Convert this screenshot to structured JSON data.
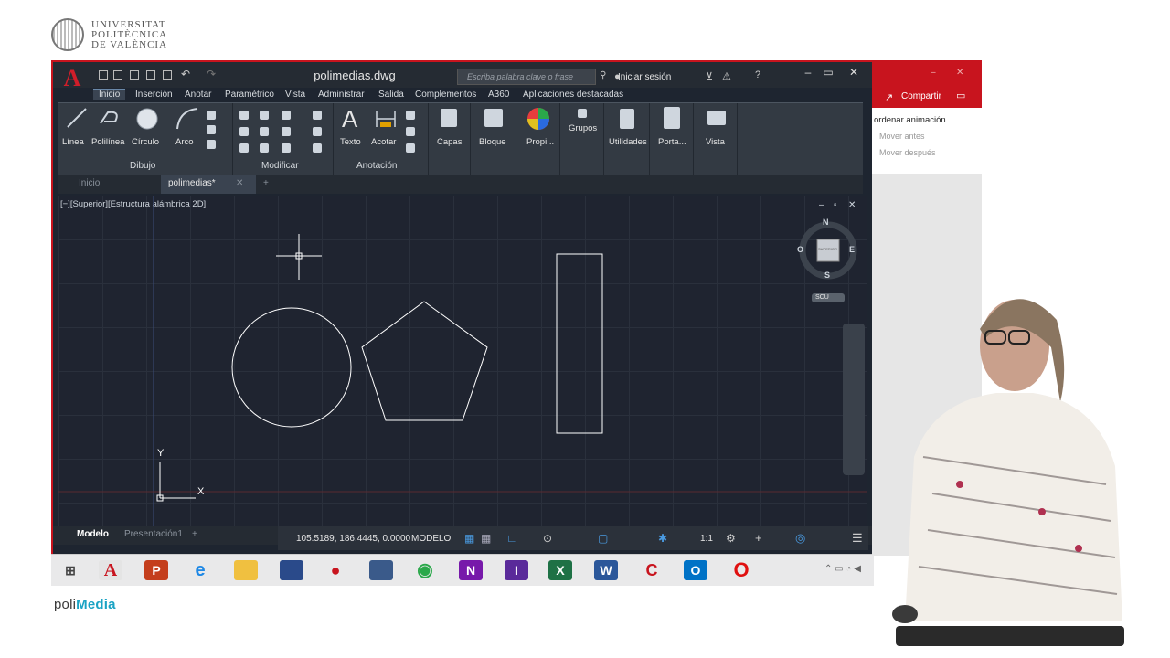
{
  "logo": {
    "line1": "UNIVERSITAT",
    "line2": "POLITÈCNICA",
    "line3": "DE VALÈNCIA"
  },
  "window": {
    "title": "polimedias.dwg",
    "search_placeholder": "Escriba palabra clave o frase",
    "signin": "Iniciar sesión"
  },
  "ribbon_tabs": [
    "Inicio",
    "Inserción",
    "Anotar",
    "Paramétrico",
    "Vista",
    "Administrar",
    "Salida",
    "Complementos",
    "A360",
    "Aplicaciones destacadas"
  ],
  "tools": {
    "linea": "Línea",
    "polilinea": "Polilínea",
    "circulo": "Círculo",
    "arco": "Arco",
    "texto": "Texto",
    "acotar": "Acotar",
    "capas": "Capas",
    "bloque": "Bloque",
    "propi": "Propi...",
    "grupos": "Grupos",
    "utilidades": "Utilidades",
    "porta": "Porta...",
    "vista": "Vista"
  },
  "panels": {
    "dibujo": "Dibujo",
    "modificar": "Modificar",
    "anotacion": "Anotación"
  },
  "doc_tabs": {
    "inicio": "Inicio",
    "active": "polimedias*",
    "new": "+"
  },
  "viewport": {
    "label": "[−][Superior][Estructura alámbrica 2D]",
    "compass": {
      "n": "N",
      "s": "S",
      "e": "E",
      "w": "O",
      "cube": "SUPERIOR",
      "ucs": "SCU"
    },
    "axis_x": "X",
    "axis_y": "Y"
  },
  "model_tabs": {
    "modelo": "Modelo",
    "presentacion": "Presentación1",
    "add": "+"
  },
  "status": {
    "coords": "105.5189, 186.4445, 0.0000",
    "mode": "MODELO",
    "scale": "1:1"
  },
  "ppt": {
    "share": "Compartir",
    "animation": "ordenar animación",
    "move_before": "Mover antes",
    "move_after": "Mover después"
  },
  "footer": {
    "poli": "poli",
    "media": "Media"
  },
  "colors": {
    "accent": "#c8141e",
    "autocad_bg": "#1f2430",
    "polimedia_blue": "#1aa3c4"
  }
}
